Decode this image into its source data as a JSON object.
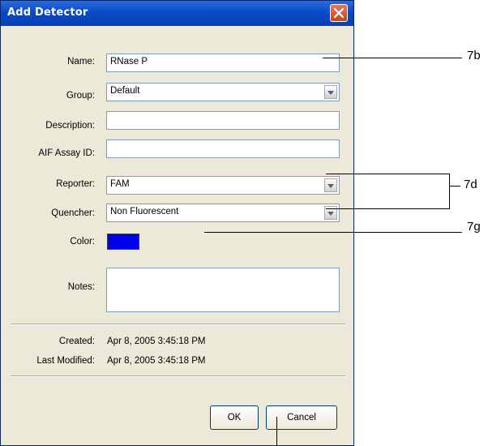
{
  "dialog": {
    "title": "Add Detector",
    "fields": {
      "name": {
        "label": "Name:",
        "value": "RNase P"
      },
      "group": {
        "label": "Group:",
        "value": "Default"
      },
      "description": {
        "label": "Description:",
        "value": ""
      },
      "aif_assay_id": {
        "label": "AIF Assay ID:",
        "value": ""
      },
      "reporter": {
        "label": "Reporter:",
        "value": "FAM"
      },
      "quencher": {
        "label": "Quencher:",
        "value": "Non Fluorescent"
      },
      "color": {
        "label": "Color:",
        "value": "#0000f0"
      },
      "notes": {
        "label": "Notes:",
        "value": ""
      }
    },
    "info": {
      "created_label": "Created:",
      "created_value": "Apr 8, 2005 3:45:18 PM",
      "modified_label": "Last Modified:",
      "modified_value": "Apr 8, 2005 3:45:18 PM"
    },
    "buttons": {
      "ok": "OK",
      "cancel": "Cancel"
    }
  },
  "callouts": {
    "b": "7b",
    "d": "7d",
    "g": "7g"
  }
}
